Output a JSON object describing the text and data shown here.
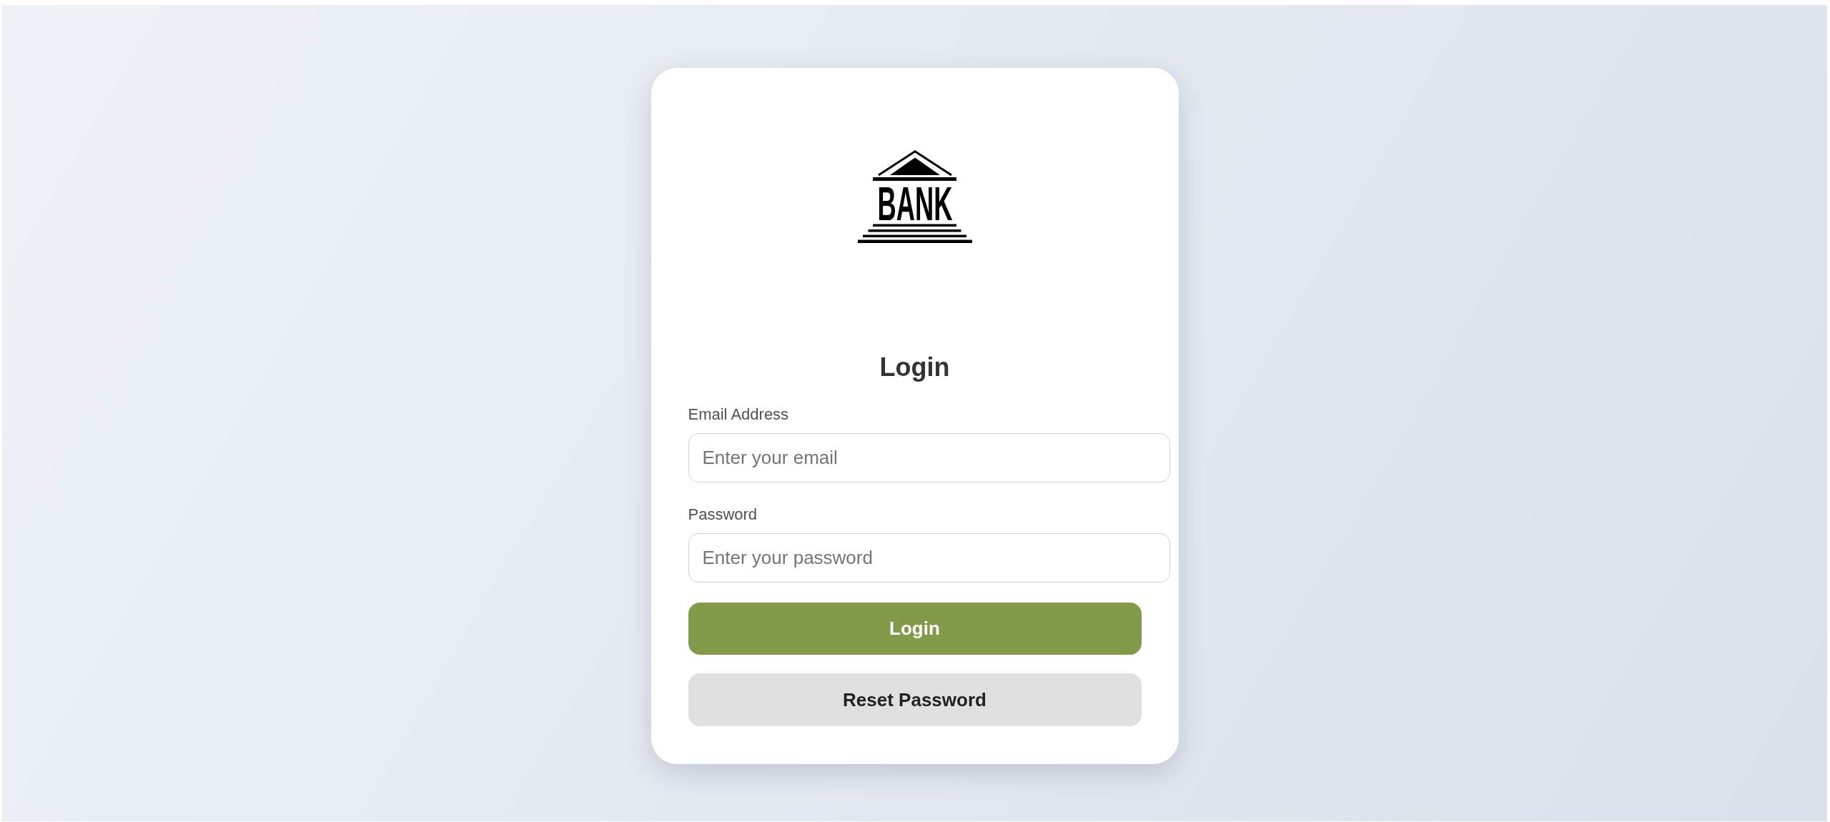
{
  "logo": {
    "text": "BANK"
  },
  "heading": "Login",
  "fields": [
    {
      "label": "Email Address",
      "placeholder": "Enter your email"
    },
    {
      "label": "Password",
      "placeholder": "Enter your password"
    }
  ],
  "buttons": [
    {
      "label": "Login",
      "kind": "primary"
    },
    {
      "label": "Reset Password",
      "kind": "secondary"
    }
  ]
}
